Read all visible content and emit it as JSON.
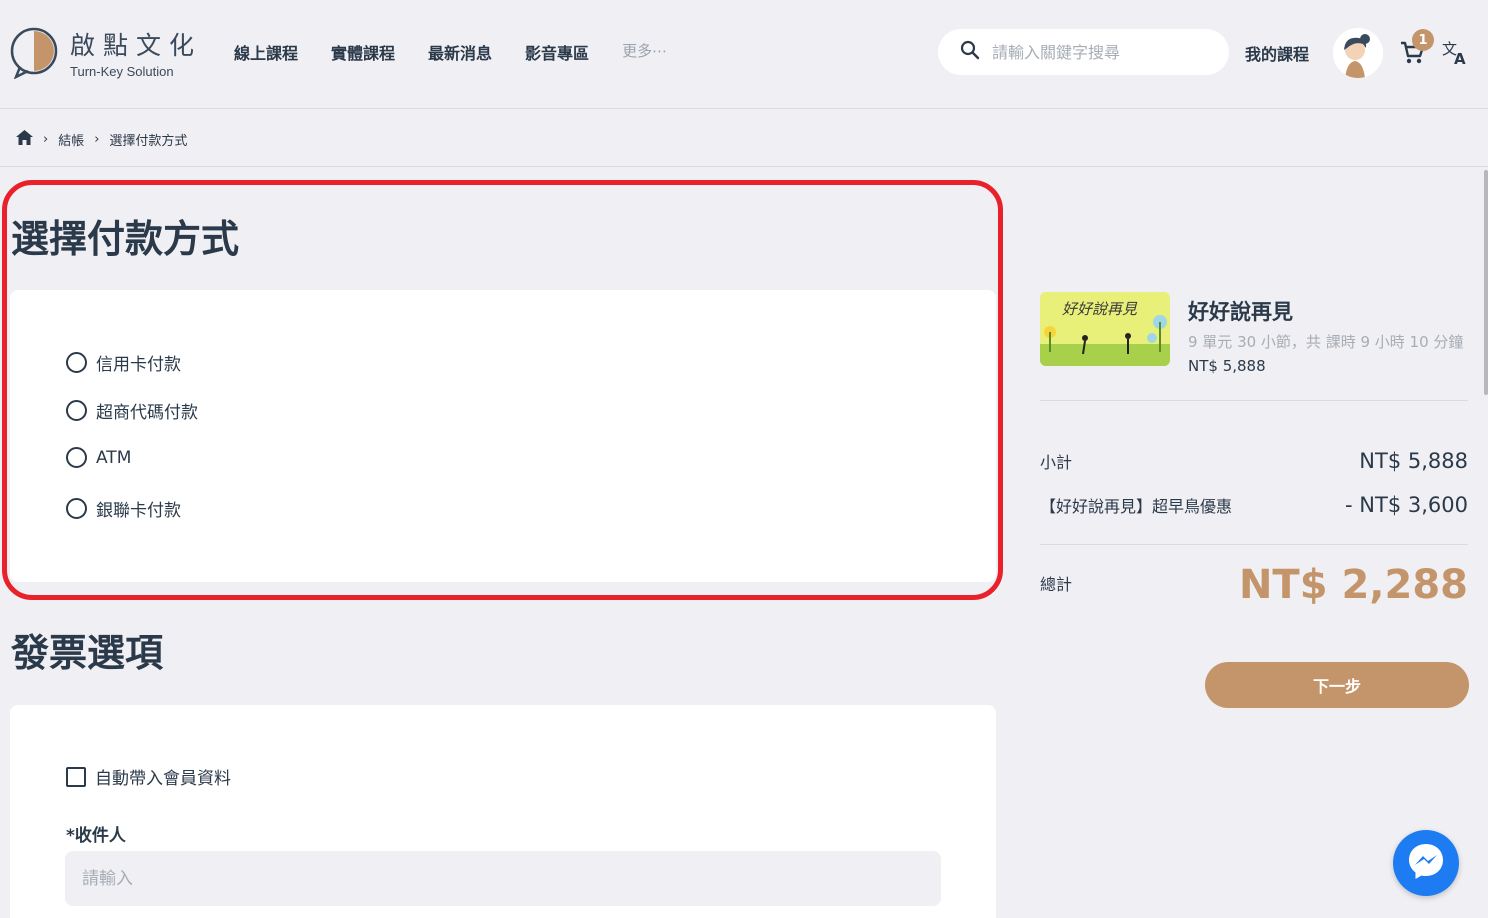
{
  "brand": {
    "name_cn": "啟點文化",
    "name_en": "Turn-Key Solution"
  },
  "nav": {
    "items": [
      "線上課程",
      "實體課程",
      "最新消息",
      "影音專區"
    ],
    "more": "更多⋯"
  },
  "search": {
    "placeholder": "請輸入關鍵字搜尋"
  },
  "header": {
    "my_courses": "我的課程",
    "cart_count": "1"
  },
  "breadcrumb": {
    "items": [
      "結帳",
      "選擇付款方式"
    ]
  },
  "payment": {
    "title": "選擇付款方式",
    "options": [
      "信用卡付款",
      "超商代碼付款",
      "ATM",
      "銀聯卡付款"
    ]
  },
  "invoice": {
    "title": "發票選項",
    "auto_fill_label": "自動帶入會員資料",
    "recipient_label": "*收件人",
    "recipient_placeholder": "請輸入"
  },
  "order": {
    "course_name": "好好說再見",
    "course_meta": "9 單元 30 小節，共 課時 9 小時 10 分鐘",
    "course_price": "NT$ 5,888",
    "thumb_text": "好好說再見",
    "subtotal_label": "小計",
    "subtotal_value": "NT$ 5,888",
    "discount_label": "【好好說再見】超早鳥優惠",
    "discount_value": "- NT$ 3,600",
    "total_label": "總計",
    "total_value": "NT$ 2,288",
    "next_button": "下一步"
  },
  "colors": {
    "accent": "#c4956a",
    "highlight": "#e8212b",
    "messenger": "#1e7cf2"
  }
}
